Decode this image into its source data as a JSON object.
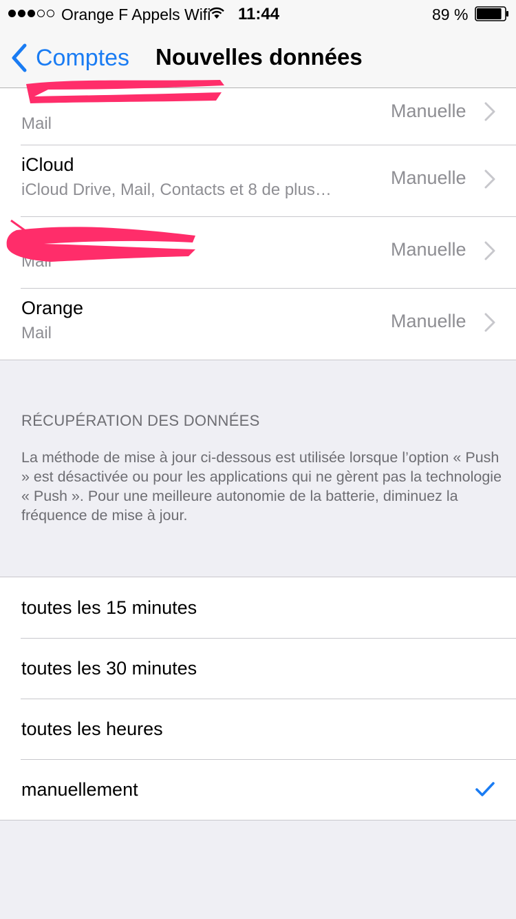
{
  "status_bar": {
    "carrier": "Orange F Appels Wifi",
    "time": "11:44",
    "battery": "89 %",
    "signal_bars_filled": 3,
    "signal_bars_total": 5,
    "battery_level": 0.89
  },
  "nav": {
    "back_label": "Comptes",
    "title": "Nouvelles données"
  },
  "accounts": [
    {
      "name": "",
      "subtitle": "Mail",
      "value": "Manuelle",
      "redacted": true
    },
    {
      "name": "iCloud",
      "subtitle": "iCloud Drive, Mail, Contacts et 8 de plus…",
      "value": "Manuelle",
      "redacted": false
    },
    {
      "name": "",
      "subtitle": "Mail",
      "value": "Manuelle",
      "redacted": true
    },
    {
      "name": "Orange",
      "subtitle": "Mail",
      "value": "Manuelle",
      "redacted": false
    }
  ],
  "fetch_section": {
    "header": "RÉCUPÉRATION DES DONNÉES",
    "description": "La méthode de mise à jour ci-dessous est utilisée lorsque l’option « Push » est désactivée ou pour les applications qui ne gèrent pas la technologie « Push ». Pour une meilleure autonomie de la batterie, diminuez la fréquence de mise à jour."
  },
  "options": [
    {
      "label": "toutes les 15 minutes",
      "selected": false
    },
    {
      "label": "toutes les 30 minutes",
      "selected": false
    },
    {
      "label": "toutes les heures",
      "selected": false
    },
    {
      "label": "manuellement",
      "selected": true
    }
  ],
  "colors": {
    "accent": "#1a7cf3",
    "redaction": "#ff2d6a",
    "background": "#efeff4",
    "secondary_text": "#8e8e93"
  }
}
